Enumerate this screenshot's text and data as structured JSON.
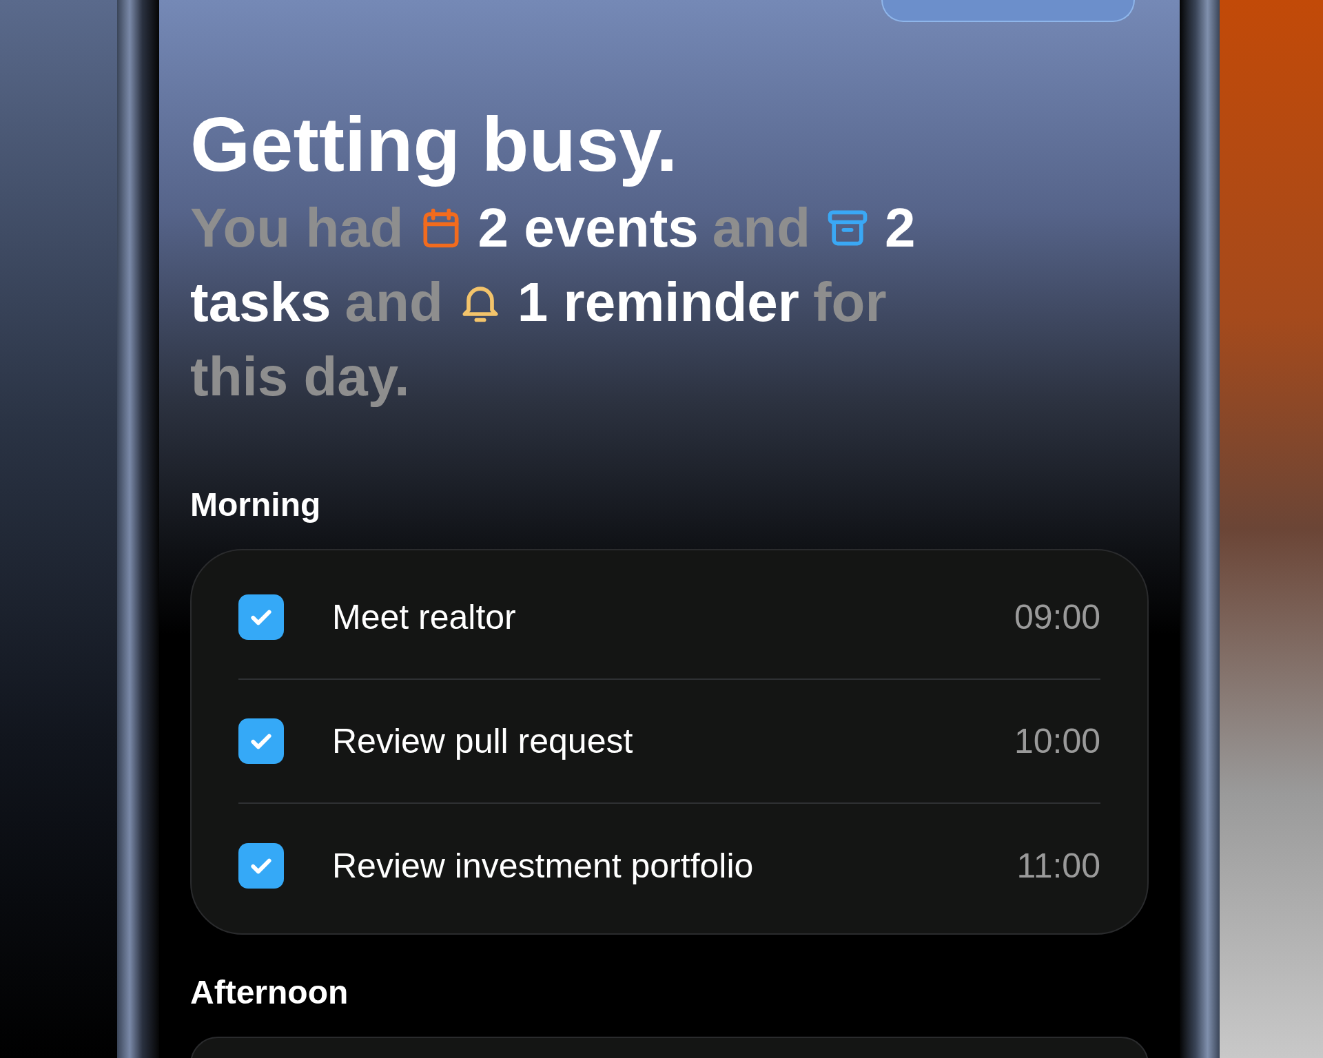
{
  "header": {
    "title": "Getting busy."
  },
  "summary": [
    {
      "kind": "text",
      "text": "You had",
      "emphasis": false
    },
    {
      "kind": "calendar",
      "color": "#f26b1d"
    },
    {
      "kind": "text",
      "text": "2 events",
      "emphasis": true
    },
    {
      "kind": "text",
      "text": "and",
      "emphasis": false
    },
    {
      "kind": "archive",
      "color": "#3aa8f5"
    },
    {
      "kind": "text",
      "text": "2",
      "emphasis": true
    },
    {
      "kind": "text",
      "text": "tasks",
      "emphasis": true
    },
    {
      "kind": "text",
      "text": "and",
      "emphasis": false
    },
    {
      "kind": "bell",
      "color": "#f3c46b"
    },
    {
      "kind": "text",
      "text": "1 reminder",
      "emphasis": true
    },
    {
      "kind": "text",
      "text": "for",
      "emphasis": false
    },
    {
      "kind": "text",
      "text": "this day.",
      "emphasis": false
    }
  ],
  "sections": [
    {
      "title": "Morning",
      "items": [
        {
          "title": "Meet realtor",
          "time": "09:00",
          "checked": true
        },
        {
          "title": "Review pull request",
          "time": "10:00",
          "checked": true
        },
        {
          "title": "Review investment portfolio",
          "time": "11:00",
          "checked": true
        }
      ]
    },
    {
      "title": "Afternoon"
    }
  ]
}
